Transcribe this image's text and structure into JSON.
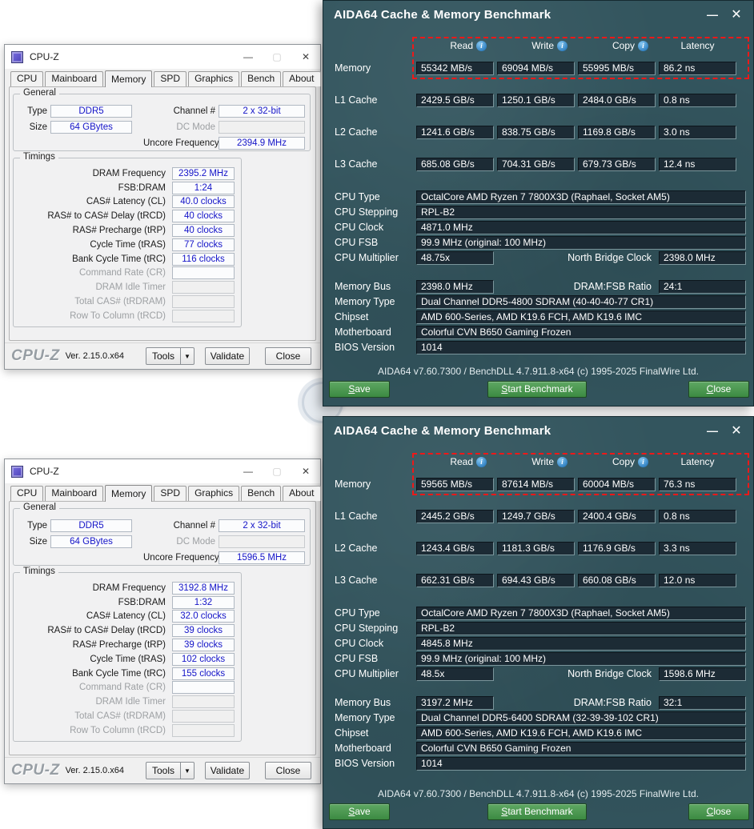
{
  "icons": {
    "minimize": "—",
    "maximize": "▢",
    "close": "✕",
    "dropdown": "▼",
    "info": "i"
  },
  "cpuz_top": {
    "title": "CPU-Z",
    "tabs": [
      "CPU",
      "Mainboard",
      "Memory",
      "SPD",
      "Graphics",
      "Bench",
      "About"
    ],
    "general": {
      "title": "General",
      "type_label": "Type",
      "type_value": "DDR5",
      "size_label": "Size",
      "size_value": "64 GBytes",
      "channel_label": "Channel #",
      "channel_value": "2 x 32-bit",
      "dc_mode_label": "DC Mode",
      "dc_mode_value": "",
      "uncore_label": "Uncore Frequency",
      "uncore_value": "2394.9 MHz"
    },
    "timings": {
      "title": "Timings",
      "rows": [
        {
          "label": "DRAM Frequency",
          "value": "2395.2 MHz"
        },
        {
          "label": "FSB:DRAM",
          "value": "1:24"
        },
        {
          "label": "CAS# Latency (CL)",
          "value": "40.0 clocks"
        },
        {
          "label": "RAS# to CAS# Delay (tRCD)",
          "value": "40 clocks"
        },
        {
          "label": "RAS# Precharge (tRP)",
          "value": "40 clocks"
        },
        {
          "label": "Cycle Time (tRAS)",
          "value": "77 clocks"
        },
        {
          "label": "Bank Cycle Time (tRC)",
          "value": "116 clocks"
        },
        {
          "label": "Command Rate (CR)",
          "value": ""
        },
        {
          "label": "DRAM Idle Timer",
          "value": ""
        },
        {
          "label": "Total CAS# (tRDRAM)",
          "value": ""
        },
        {
          "label": "Row To Column (tRCD)",
          "value": ""
        }
      ]
    },
    "footer": {
      "logo": "CPU-Z",
      "version": "Ver. 2.15.0.x64",
      "tools_label": "Tools",
      "validate_label": "Validate",
      "close_label": "Close"
    }
  },
  "cpuz_bottom": {
    "title": "CPU-Z",
    "tabs": [
      "CPU",
      "Mainboard",
      "Memory",
      "SPD",
      "Graphics",
      "Bench",
      "About"
    ],
    "general": {
      "title": "General",
      "type_label": "Type",
      "type_value": "DDR5",
      "size_label": "Size",
      "size_value": "64 GBytes",
      "channel_label": "Channel #",
      "channel_value": "2 x 32-bit",
      "dc_mode_label": "DC Mode",
      "dc_mode_value": "",
      "uncore_label": "Uncore Frequency",
      "uncore_value": "1596.5 MHz"
    },
    "timings": {
      "title": "Timings",
      "rows": [
        {
          "label": "DRAM Frequency",
          "value": "3192.8 MHz"
        },
        {
          "label": "FSB:DRAM",
          "value": "1:32"
        },
        {
          "label": "CAS# Latency (CL)",
          "value": "32.0 clocks"
        },
        {
          "label": "RAS# to CAS# Delay (tRCD)",
          "value": "39 clocks"
        },
        {
          "label": "RAS# Precharge (tRP)",
          "value": "39 clocks"
        },
        {
          "label": "Cycle Time (tRAS)",
          "value": "102 clocks"
        },
        {
          "label": "Bank Cycle Time (tRC)",
          "value": "155 clocks"
        },
        {
          "label": "Command Rate (CR)",
          "value": ""
        },
        {
          "label": "DRAM Idle Timer",
          "value": ""
        },
        {
          "label": "Total CAS# (tRDRAM)",
          "value": ""
        },
        {
          "label": "Row To Column (tRCD)",
          "value": ""
        }
      ]
    },
    "footer": {
      "logo": "CPU-Z",
      "version": "Ver. 2.15.0.x64",
      "tools_label": "Tools",
      "validate_label": "Validate",
      "close_label": "Close"
    }
  },
  "aida_top": {
    "title": "AIDA64 Cache & Memory Benchmark",
    "columns": [
      "Read",
      "Write",
      "Copy",
      "Latency"
    ],
    "rows": [
      {
        "label": "Memory",
        "values": [
          "55342 MB/s",
          "69094 MB/s",
          "55995 MB/s",
          "86.2 ns"
        ]
      },
      {
        "label": "L1 Cache",
        "values": [
          "2429.5 GB/s",
          "1250.1 GB/s",
          "2484.0 GB/s",
          "0.8 ns"
        ]
      },
      {
        "label": "L2 Cache",
        "values": [
          "1241.6 GB/s",
          "838.75 GB/s",
          "1169.8 GB/s",
          "3.0 ns"
        ]
      },
      {
        "label": "L3 Cache",
        "values": [
          "685.08 GB/s",
          "704.31 GB/s",
          "679.73 GB/s",
          "12.4 ns"
        ]
      }
    ],
    "info": {
      "cpu_type_label": "CPU Type",
      "cpu_type": "OctalCore AMD Ryzen 7 7800X3D  (Raphael, Socket AM5)",
      "cpu_stepping_label": "CPU Stepping",
      "cpu_stepping": "RPL-B2",
      "cpu_clock_label": "CPU Clock",
      "cpu_clock": "4871.0 MHz",
      "cpu_fsb_label": "CPU FSB",
      "cpu_fsb": "99.9 MHz  (original: 100 MHz)",
      "cpu_multiplier_label": "CPU Multiplier",
      "cpu_multiplier": "48.75x",
      "nb_clock_label": "North Bridge Clock",
      "nb_clock": "2398.0 MHz",
      "memory_bus_label": "Memory Bus",
      "memory_bus": "2398.0 MHz",
      "dram_fsb_label": "DRAM:FSB Ratio",
      "dram_fsb": "24:1",
      "memory_type_label": "Memory Type",
      "memory_type": "Dual Channel DDR5-4800 SDRAM  (40-40-40-77 CR1)",
      "chipset_label": "Chipset",
      "chipset": "AMD 600-Series, AMD K19.6 FCH, AMD K19.6 IMC",
      "motherboard_label": "Motherboard",
      "motherboard": "Colorful CVN B650 Gaming Frozen",
      "bios_label": "BIOS Version",
      "bios": "1014"
    },
    "footer": "AIDA64 v7.60.7300 / BenchDLL 4.7.911.8-x64  (c) 1995-2025 FinalWire Ltd.",
    "buttons": {
      "save": "Save",
      "start": "Start Benchmark",
      "close": "Close"
    }
  },
  "aida_bottom": {
    "title": "AIDA64 Cache & Memory Benchmark",
    "columns": [
      "Read",
      "Write",
      "Copy",
      "Latency"
    ],
    "rows": [
      {
        "label": "Memory",
        "values": [
          "59565 MB/s",
          "87614 MB/s",
          "60004 MB/s",
          "76.3 ns"
        ]
      },
      {
        "label": "L1 Cache",
        "values": [
          "2445.2 GB/s",
          "1249.7 GB/s",
          "2400.4 GB/s",
          "0.8 ns"
        ]
      },
      {
        "label": "L2 Cache",
        "values": [
          "1243.4 GB/s",
          "1181.3 GB/s",
          "1176.9 GB/s",
          "3.3 ns"
        ]
      },
      {
        "label": "L3 Cache",
        "values": [
          "662.31 GB/s",
          "694.43 GB/s",
          "660.08 GB/s",
          "12.0 ns"
        ]
      }
    ],
    "info": {
      "cpu_type_label": "CPU Type",
      "cpu_type": "OctalCore AMD Ryzen 7 7800X3D  (Raphael, Socket AM5)",
      "cpu_stepping_label": "CPU Stepping",
      "cpu_stepping": "RPL-B2",
      "cpu_clock_label": "CPU Clock",
      "cpu_clock": "4845.8 MHz",
      "cpu_fsb_label": "CPU FSB",
      "cpu_fsb": "99.9 MHz  (original: 100 MHz)",
      "cpu_multiplier_label": "CPU Multiplier",
      "cpu_multiplier": "48.5x",
      "nb_clock_label": "North Bridge Clock",
      "nb_clock": "1598.6 MHz",
      "memory_bus_label": "Memory Bus",
      "memory_bus": "3197.2 MHz",
      "dram_fsb_label": "DRAM:FSB Ratio",
      "dram_fsb": "32:1",
      "memory_type_label": "Memory Type",
      "memory_type": "Dual Channel DDR5-6400 SDRAM  (32-39-39-102 CR1)",
      "chipset_label": "Chipset",
      "chipset": "AMD 600-Series, AMD K19.6 FCH, AMD K19.6 IMC",
      "motherboard_label": "Motherboard",
      "motherboard": "Colorful CVN B650 Gaming Frozen",
      "bios_label": "BIOS Version",
      "bios": "1014"
    },
    "footer": "AIDA64 v7.60.7300 / BenchDLL 4.7.911.8-x64  (c) 1995-2025 FinalWire Ltd.",
    "buttons": {
      "save": "Save",
      "start": "Start Benchmark",
      "close": "Close"
    }
  }
}
